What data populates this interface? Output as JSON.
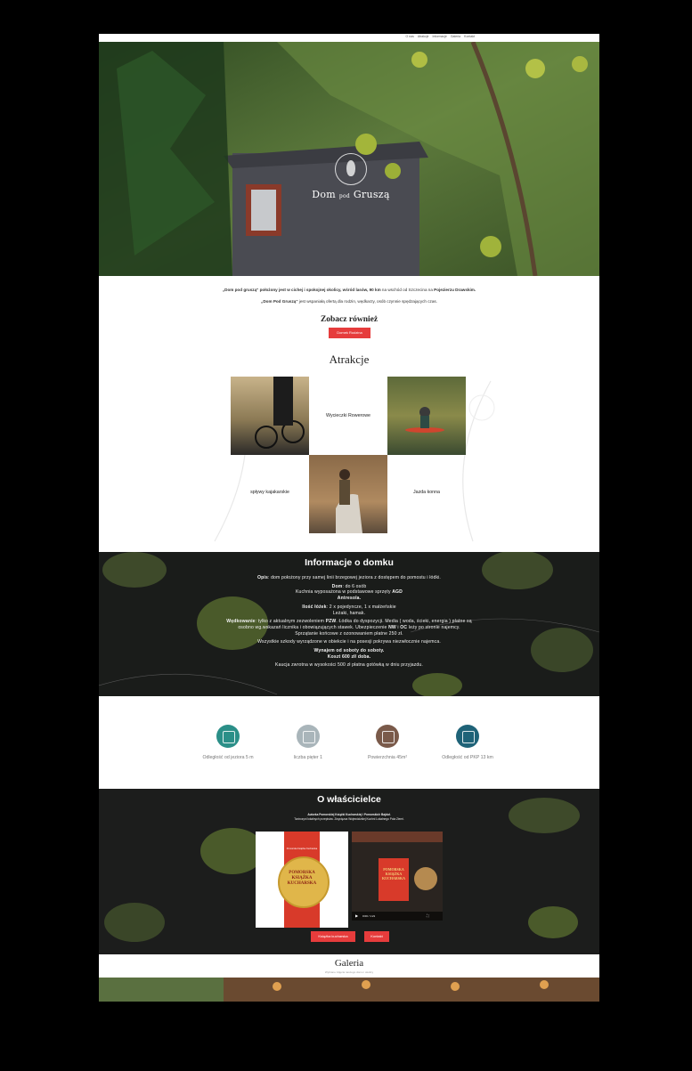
{
  "nav": {
    "links": [
      "O nas",
      "Atrakcje",
      "Informacje",
      "Galeria",
      "Kontakt"
    ]
  },
  "hero": {
    "brand_a": "Dom",
    "brand_b": "pod",
    "brand_c": "Gruszą"
  },
  "intro": {
    "line1_a": "„Dom pod gruszą\" położony jest w cichej i spokojnej okolicy, wśród lasów, ",
    "line1_b": "90 km",
    "line1_c": " na wschód od Szczecina na ",
    "line1_d": "Pojezierzu Drawskim.",
    "line2_a": "„Dom Pod Gruszą\"",
    "line2_b": "  jest wspaniałą ofertą dla rodzin, wędkarzy, osób czynnie spędzających czas."
  },
  "see_also": {
    "heading": "Zobacz również",
    "button": "Domek Rodzina"
  },
  "attractions": {
    "heading": "Atrakcje",
    "items": [
      "Wycieczki Rowerowe",
      "spływy kajakarskie",
      "Jazda konna"
    ]
  },
  "info": {
    "title": "Informacje o domku",
    "opis_label": "Opis",
    "opis_text": ": dom położony przy samej linii brzegowej jeziora z dostępem do pomostu i łódki.",
    "dom_label": "Dom",
    "dom_text": ": do 6 osób",
    "kitchen_a": "Kuchnia wyposażona w podstawowe sprzęty ",
    "kitchen_b": "AGD",
    "antresola": "Antresola.",
    "beds_label": "Ilość łóżek",
    "beds_text": ": 2 x pojedyncze, 1 x małżeńskie",
    "beds_extra": "Leżaki, hamak.",
    "fishing_label": "Wędkowanie",
    "fishing_a": ": tylko z aktualnym zezwoleniem ",
    "fishing_b": "PZW",
    "fishing_c": ". Łódka do dyspozycji. Media ( woda, ścieki, energia ) płatne są osobno wg.wskazań licznika i obowiązujących stawek. Ubezpieczenie ",
    "fishing_d": "NW",
    "fishing_e": " i ",
    "fishing_f": "OC",
    "fishing_g": " leży po stronie najemcy.",
    "cleaning": "Sprzątanie końcowe z ozonowaniem płatne 250 zł.",
    "damage": "Wszystkie szkody wyrządzone w obiekcie i na posesji pokrywa niezwłocznie najemca.",
    "rent_a": "Wynajem od soboty do soboty.",
    "rent_b": "Koszt 600 zł/ doba.",
    "deposit": "Kaucja zwrotna w wysokości 500 zł płatna gotówką w dniu przyjazdu."
  },
  "stats": [
    {
      "label": "Odległość od jeziora 5 m",
      "icon": "waves-icon",
      "color": "#2b8f88"
    },
    {
      "label": "liczba pięter 1",
      "icon": "stairs-icon",
      "color": "#a9b5ba"
    },
    {
      "label": "Powierzchnia 45m²",
      "icon": "floor-area-icon",
      "color": "#7a5a4a"
    },
    {
      "label": "Odległość od PKP 13 km",
      "icon": "train-icon",
      "color": "#1f6378"
    }
  ],
  "owner": {
    "title": "O właścicielce",
    "sub1": "Autorka Pomorskiej Książki Kucharskiej i Pomorskich Bajduł.",
    "sub2": "Twórczyni lokalnych przepisów. Zwycięzca Wojewódzkiej Kuchni Lokalnego Pola Ziemi.",
    "book_top": "Pomorska Książka Kucharska",
    "book_line1": "POMORSKA",
    "book_line2": "KSIĄŻKA",
    "book_line3": "KUCHARSKA",
    "video_line1": "POMORSKA",
    "video_line2": "KSIĄŻKA",
    "video_line3": "KUCHARSKA",
    "video_time": "0:00 / 1:21",
    "btn_book": "Książka kucharska",
    "btn_contact": "Kontakt"
  },
  "gallery": {
    "title": "Galeria",
    "subtitle": "Wybrane zdjęcia naszego domu i okolicy"
  },
  "colors": {
    "accent": "#e63c3c",
    "dark": "#1a1c1a"
  }
}
